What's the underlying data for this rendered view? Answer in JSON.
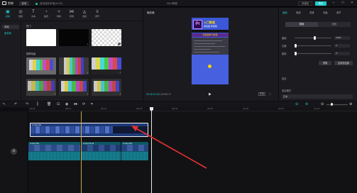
{
  "titlebar": {
    "app_name": "剪映",
    "menu_label": "菜单",
    "status": "自动保存本地(10:20)",
    "project_title": "0614草稿",
    "shortcut_label": "快捷键",
    "export_label": "导出"
  },
  "media": {
    "tools": [
      {
        "label": "媒体",
        "icon": "▣"
      },
      {
        "label": "音频",
        "icon": "◎"
      },
      {
        "label": "文本",
        "icon": "T"
      },
      {
        "label": "贴纸",
        "icon": "◔"
      },
      {
        "label": "特效",
        "icon": "✧"
      },
      {
        "label": "转场",
        "icon": "⋈"
      },
      {
        "label": "滤镜",
        "icon": "◬"
      },
      {
        "label": "调节",
        "icon": "≡"
      }
    ],
    "side_items": [
      "本地",
      "素材库"
    ],
    "section_1": "热门",
    "section_2": "故障动画",
    "download_glyph": "⤓"
  },
  "player": {
    "title": "播放器",
    "timecode_current": "00:00:10:15",
    "timecode_total": "00:00:17",
    "ratio_label": "原始",
    "overlay": {
      "pr_badge": "Pr",
      "headline": "入门教程",
      "subline": "零基础 学剪辑",
      "banner": "零基础学习剪辑"
    }
  },
  "properties": {
    "tabs": [
      "画面",
      "音频",
      "变速",
      "动画",
      "调节"
    ],
    "segment_on": "基础",
    "segment_off": "抠像",
    "rows": [
      {
        "label": "缩放",
        "value": "100%",
        "level": 0.55
      },
      {
        "label": "位置",
        "value": "0",
        "level": 0.03
      },
      {
        "label": "旋转",
        "value": "0°",
        "level": 0.03
      }
    ],
    "reset_label": "重置",
    "apply_all_label": "应用到全部",
    "blend_label": "混合",
    "mode_label": "混合模式",
    "mode_value": "正常"
  },
  "timeline": {
    "ticks": [
      "00:00",
      "|00:10",
      "|00:20",
      "|00:30",
      "|00:40",
      "|00:50",
      "|01:00",
      "|01:10",
      "|01:20"
    ],
    "clips": [
      {
        "label": "1.mp4  10s"
      },
      {
        "label": "2.mp4  15s"
      },
      {
        "label": "3.mp4  11.2s"
      },
      {
        "label": "4.mp4  10s"
      }
    ]
  },
  "colors": {
    "accent": "#1fc8c8",
    "arrow": "#e53030",
    "playhead": "#e8e8e8"
  }
}
